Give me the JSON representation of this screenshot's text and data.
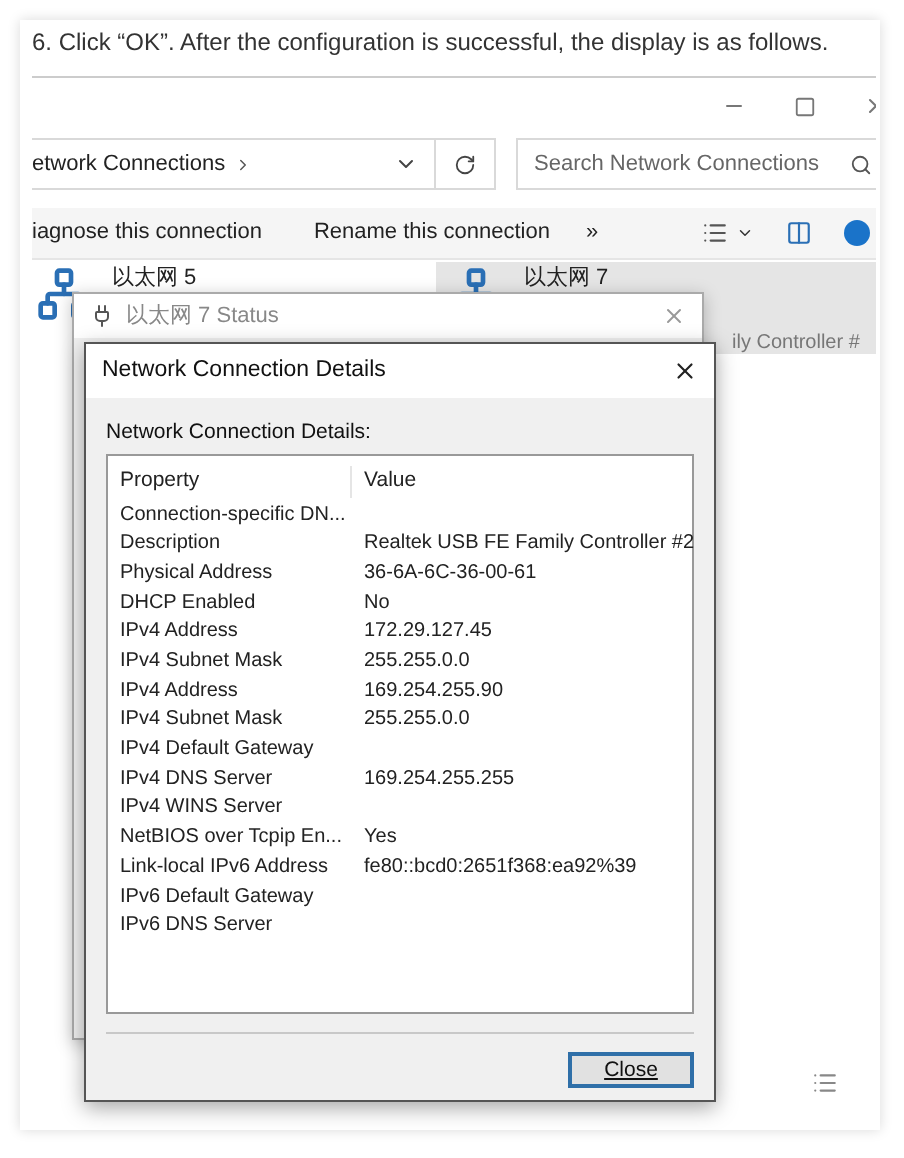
{
  "instruction": "6. Click “OK”. After the configuration is successful, the display is as follows.",
  "explorer": {
    "breadcrumb": "etwork Connections",
    "search_placeholder": "Search Network Connections",
    "commands": [
      "iagnose this connection",
      "Rename this connection"
    ],
    "more": "»",
    "connections": [
      {
        "name": "以太网 5",
        "selected": false
      },
      {
        "name": "以太网 7",
        "subtitle": "ily Controller #",
        "selected": true
      }
    ]
  },
  "status_dialog": {
    "title": "以太网 7 Status"
  },
  "details_dialog": {
    "title": "Network Connection Details",
    "label": "Network Connection Details:",
    "columns": [
      "Property",
      "Value"
    ],
    "rows": [
      [
        "Connection-specific DN...",
        ""
      ],
      [
        "Description",
        "Realtek USB FE Family Controller #2"
      ],
      [
        "Physical Address",
        "36-6A-6C-36-00-61"
      ],
      [
        "DHCP Enabled",
        "No"
      ],
      [
        "IPv4 Address",
        "172.29.127.45"
      ],
      [
        "IPv4 Subnet Mask",
        "255.255.0.0"
      ],
      [
        "IPv4 Address",
        "169.254.255.90"
      ],
      [
        "IPv4 Subnet Mask",
        "255.255.0.0"
      ],
      [
        "IPv4 Default Gateway",
        ""
      ],
      [
        "IPv4 DNS Server",
        "169.254.255.255"
      ],
      [
        "IPv4 WINS Server",
        ""
      ],
      [
        "NetBIOS over Tcpip En...",
        "Yes"
      ],
      [
        "Link-local IPv6 Address",
        "fe80::bcd0:2651f368:ea92%39"
      ],
      [
        "IPv6 Default Gateway",
        ""
      ],
      [
        "IPv6 DNS Server",
        ""
      ]
    ],
    "close_button": "Close"
  }
}
